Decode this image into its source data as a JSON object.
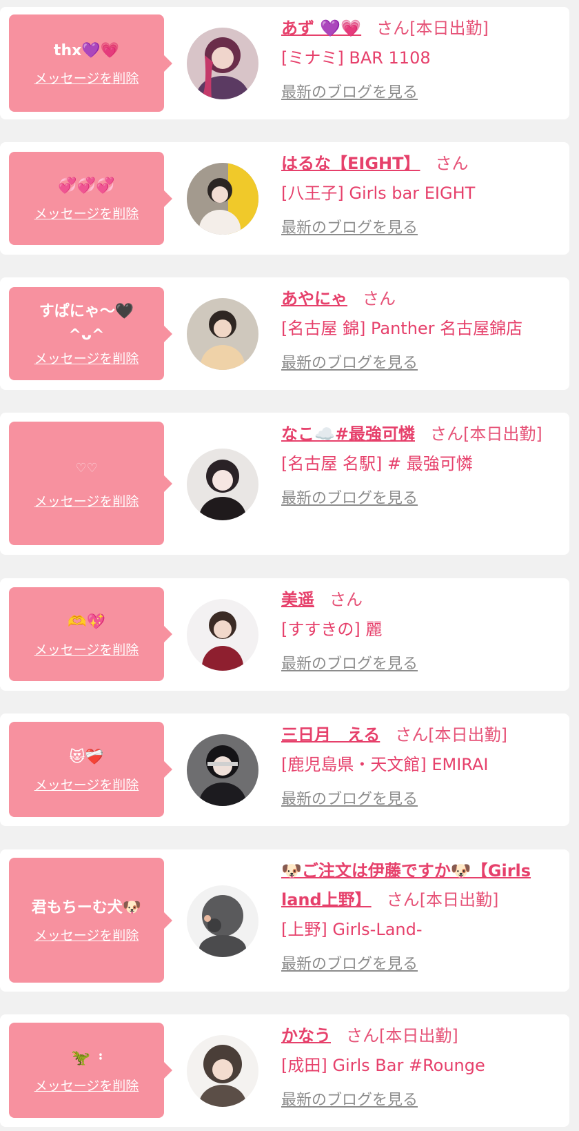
{
  "delete_label": "メッセージを削除",
  "blog_label": "最新のブログを見る",
  "san_label": "さん",
  "colors": {
    "bubble": "#f7919f",
    "name": "#e6406b",
    "link_gray": "#8c8c8c",
    "card": "#ffffff",
    "bg": "#f1f1f1"
  },
  "entries": [
    {
      "message": "thx💜💗",
      "name": "あず 💜💗",
      "status": "[本日出勤]",
      "shop": "[ミナミ] BAR 1108"
    },
    {
      "message": "💞💞💞",
      "name": "はるな【EIGHT】",
      "status": "",
      "shop": "[八王子] Girls bar EIGHT"
    },
    {
      "message": "すぱにゃ〜🖤\n^ᴗ^",
      "name": "あやにゃ",
      "status": "",
      "shop": "[名古屋 錦] Panther 名古屋錦店"
    },
    {
      "message": "♡♡",
      "name": "なこ☁️#最強可憐",
      "status": "[本日出勤]",
      "shop": "[名古屋 名駅] # 最強可憐"
    },
    {
      "message": "🫶💖",
      "name": "美遥",
      "status": "",
      "shop": "[すすきの] 麗"
    },
    {
      "message": "😻❤️‍🩹",
      "name": "三日月　える",
      "status": "[本日出勤]",
      "shop": "[鹿児島県・天文館] EMIRAI"
    },
    {
      "message": "君もちーむ犬🐶",
      "name": "🐶ご注文は伊藤ですか🐶【Girls land上野】",
      "status": "[本日出勤]",
      "shop": "[上野] Girls-Land-"
    },
    {
      "message": "🦖 ᠄",
      "name": "かなう",
      "status": "[本日出勤]",
      "shop": "[成田] Girls Bar #Rounge"
    }
  ]
}
